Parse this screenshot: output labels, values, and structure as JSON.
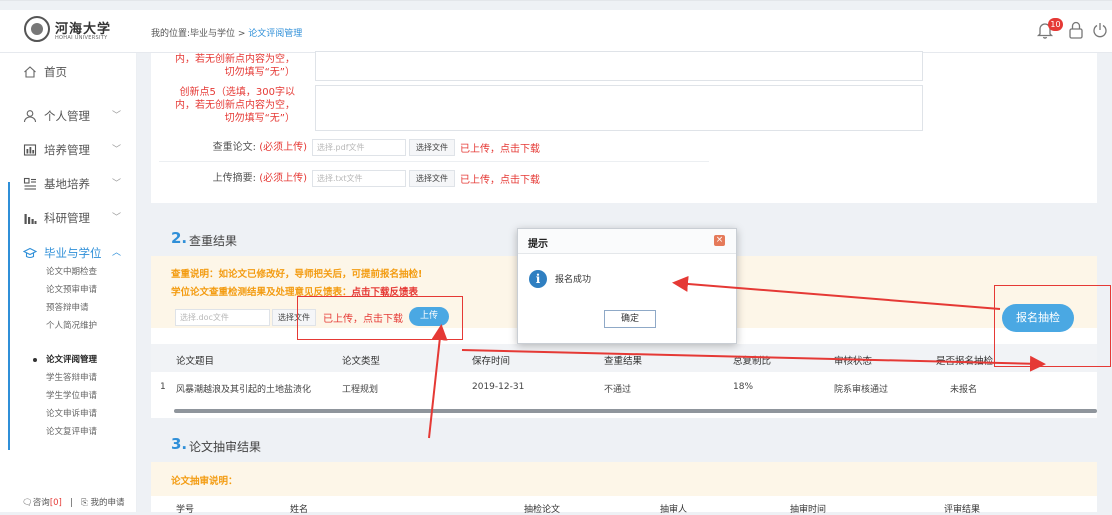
{
  "header": {
    "logo_text": "河海大学",
    "logo_sub": "HOHAI UNIVERSITY",
    "breadcrumb_prefix": "我的位置:毕业与学位 > ",
    "breadcrumb_current": "论文评阅管理",
    "notification_count": "10",
    "icons": [
      "bell-icon",
      "lock-icon",
      "power-icon"
    ]
  },
  "sidebar": {
    "home": "首页",
    "items": [
      {
        "label": "个人管理",
        "icon": "user-icon"
      },
      {
        "label": "培养管理",
        "icon": "chart-icon"
      },
      {
        "label": "基地培养",
        "icon": "grid-icon"
      },
      {
        "label": "科研管理",
        "icon": "bars-icon"
      },
      {
        "label": "毕业与学位",
        "icon": "graduation-cap-icon"
      }
    ],
    "sub_items": [
      "论文中期检查",
      "论文预审申请",
      "预答辩申请",
      "个人简况维护",
      "论文评阅管理",
      "学生答辩申请",
      "学生学位申请",
      "论文申诉申请",
      "论文复评申请"
    ],
    "footer_consult": "咨询",
    "footer_consult_count": "[0]",
    "footer_my_apply": "我的申请"
  },
  "form": {
    "innovation4_tail_line1": "内，若无创新点内容为空，",
    "innovation4_tail_line2": "切勿填写“无”）",
    "innovation5_line1": "创新点5（选填，300字以",
    "innovation5_line2": "内，若无创新点内容为空，",
    "innovation5_line3": "切勿填写“无”）",
    "check_paper_label": "查重论文:",
    "check_paper_required": "(必须上传)",
    "check_paper_placeholder": "选择.pdf文件",
    "upload_abstract_label": "上传摘要:",
    "upload_abstract_required": "(必须上传)",
    "upload_abstract_placeholder": "选择.txt文件",
    "choose_file": "选择文件",
    "uploaded_link": "已上传，点击下载"
  },
  "section2": {
    "num": "2.",
    "title": "查重结果",
    "note1": "查重说明：如论文已修改好，导师把关后，可提前报名抽检!",
    "note2_prefix": "学位论文查重检测结果及处理意见反馈表：",
    "note2_link": "点击下载反馈表",
    "doc_placeholder": "选择.doc文件",
    "choose_file": "选择文件",
    "uploaded_link": "已上传，点击下载",
    "upload_button": "上传",
    "signup_button": "报名抽检",
    "columns": [
      "论文题目",
      "论文类型",
      "保存时间",
      "查重结果",
      "总复制比",
      "审核状态",
      "是否报名抽检"
    ],
    "rows": [
      {
        "index": "1",
        "title": "风暴潮越浪及其引起的土地盐渍化",
        "type": "工程规划",
        "time": "2019-12-31",
        "result": "不通过",
        "ratio": "18%",
        "status": "院系审核通过",
        "signup": "未报名"
      }
    ]
  },
  "section3": {
    "num": "3.",
    "title": "论文抽审结果",
    "note": "论文抽审说明：",
    "columns": [
      "学号",
      "姓名",
      "抽检论文",
      "抽审人",
      "抽审时间",
      "评审结果"
    ]
  },
  "dialog": {
    "title": "提示",
    "message": "报名成功",
    "ok": "确定"
  },
  "colors": {
    "accent": "#2f8fd8",
    "annotation_red": "#e53935",
    "warning_orange": "#f39c12",
    "button_blue": "#4aa8e3"
  }
}
